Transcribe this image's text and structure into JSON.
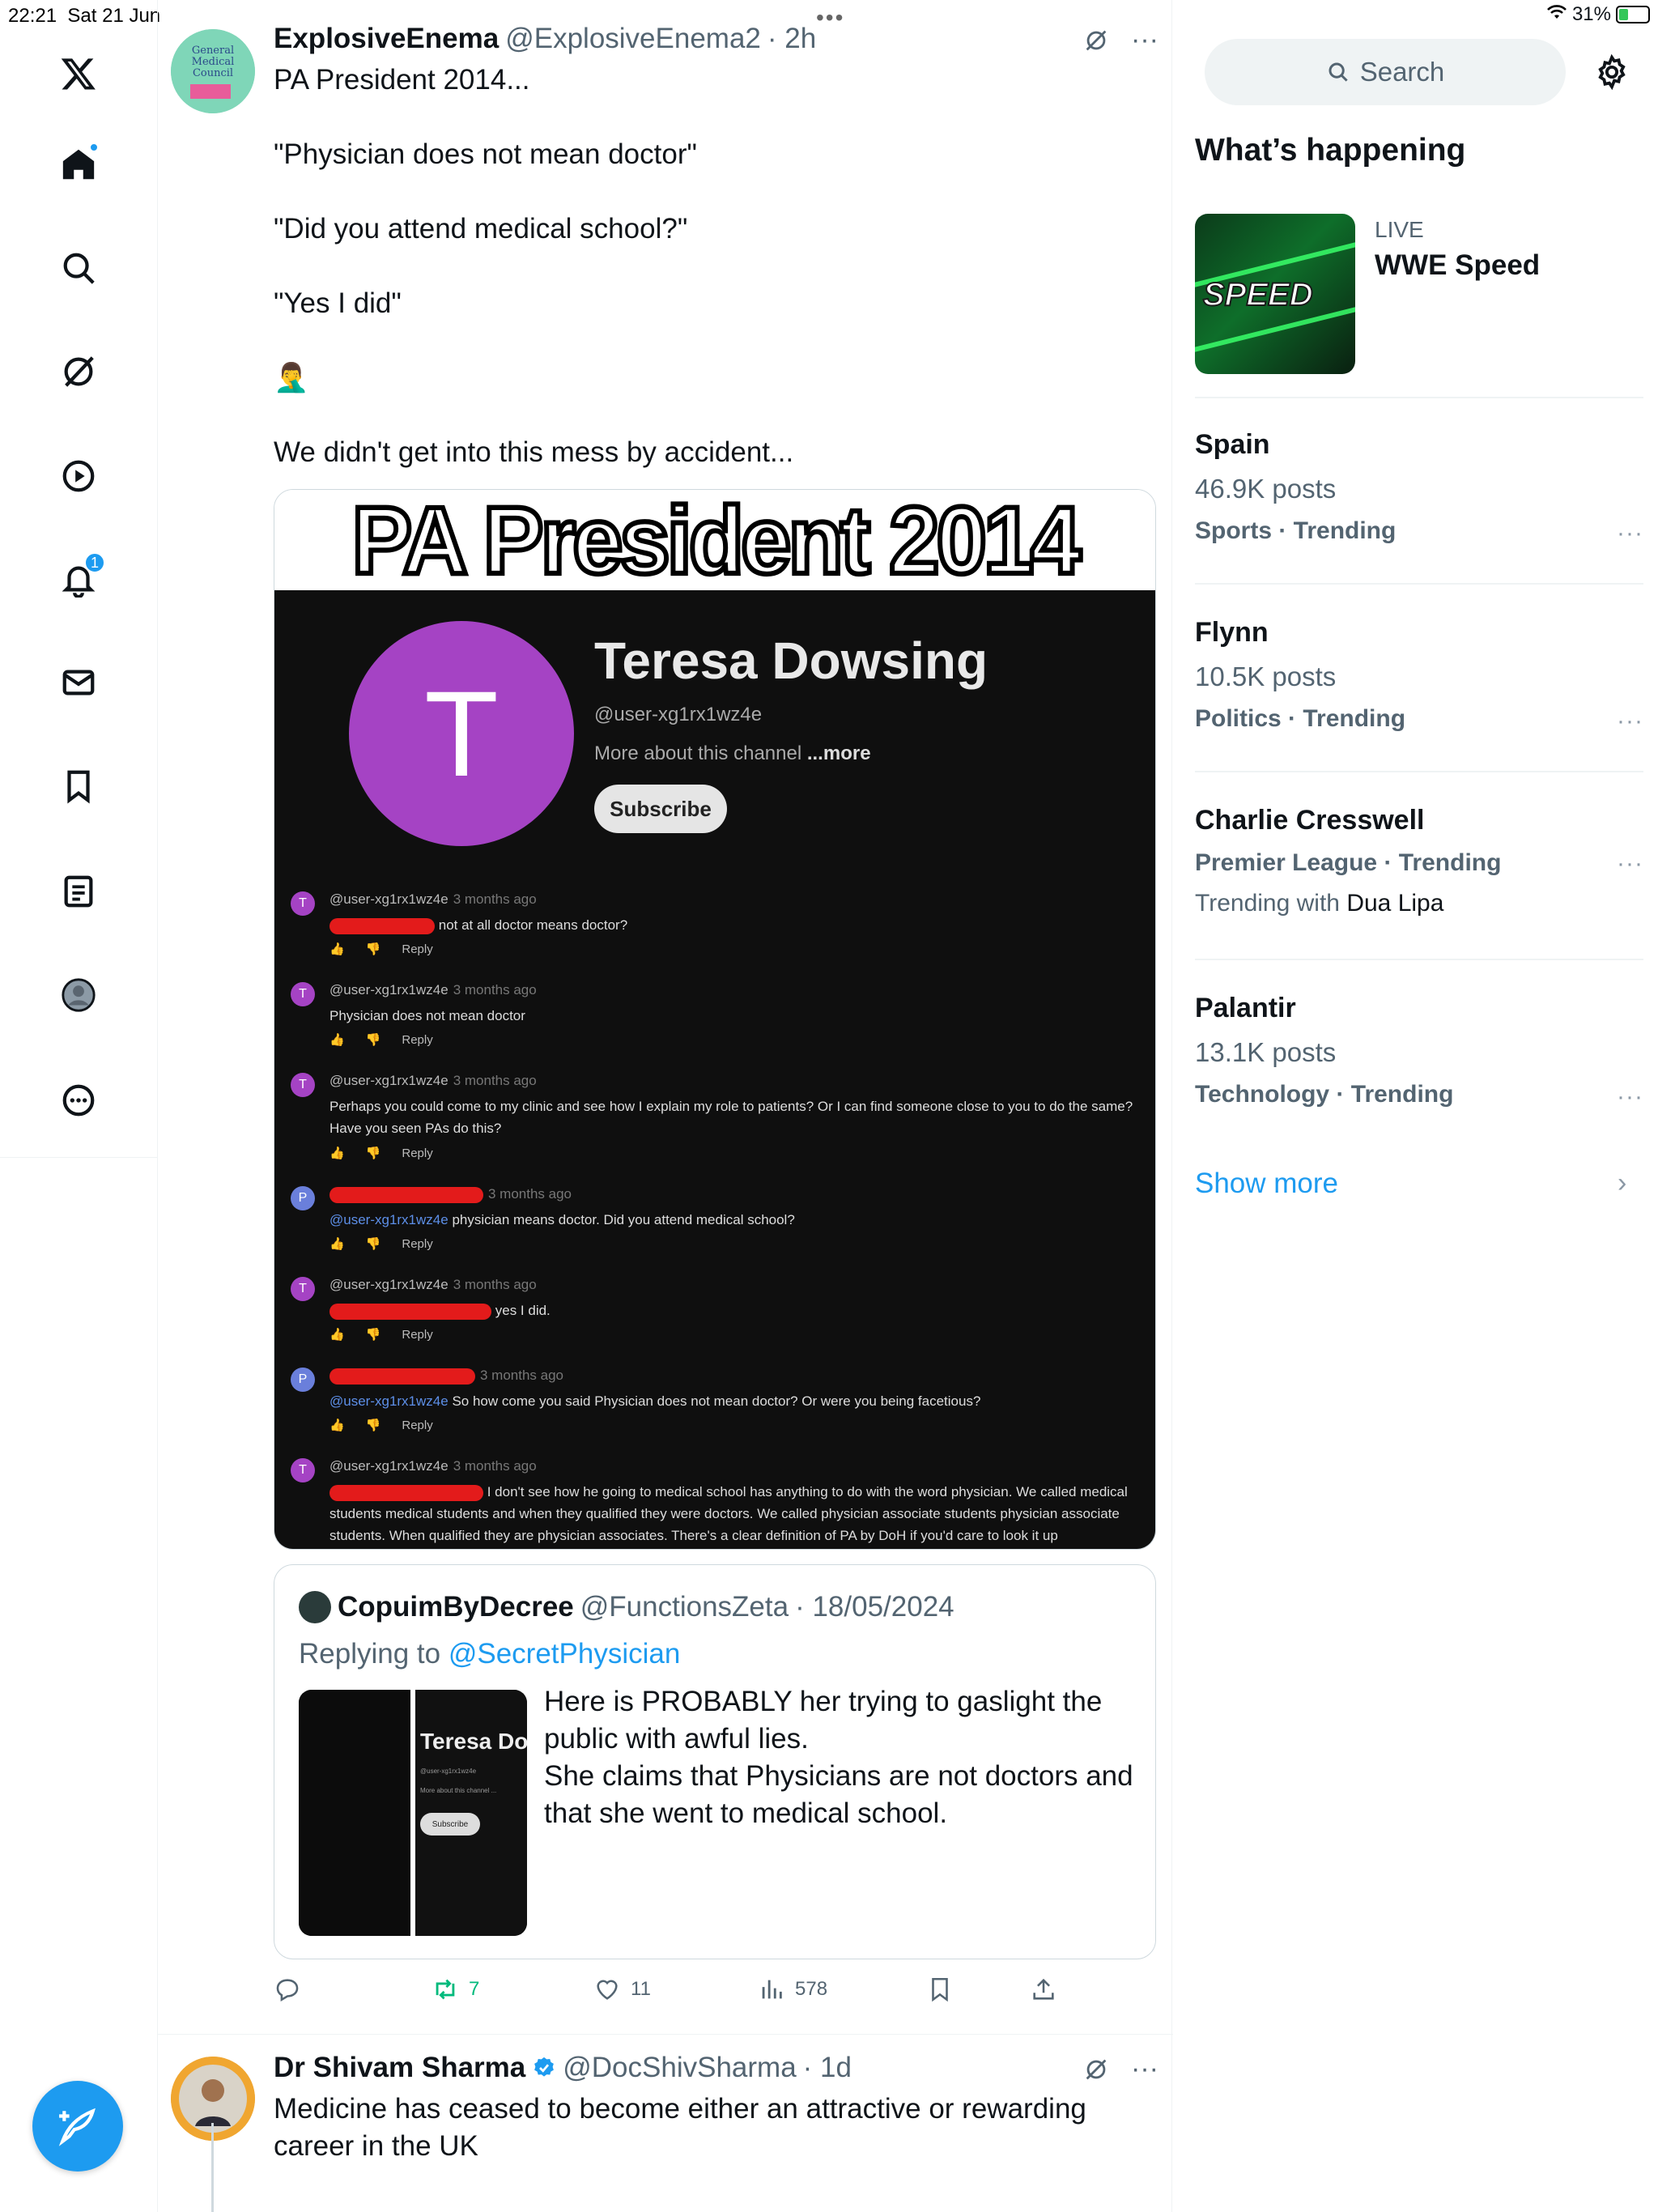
{
  "status": {
    "time": "22:21",
    "date": "Sat 21 Jun",
    "battery": "31%",
    "battery_level": 0.31
  },
  "nav": {
    "notifications_badge": "1"
  },
  "tweet1": {
    "name": "ExplosiveEnema",
    "handle": "@ExplosiveEnema2",
    "time": "· 2h",
    "lines": [
      "PA President 2014...",
      "\"Physician does not mean doctor\"",
      "\"Did you attend medical school?\"",
      "\"Yes I did\"",
      "🤦‍♂️",
      "We didn't get into this mess by accident..."
    ],
    "media": {
      "banner": "PA President 2014",
      "channel_initial": "T",
      "channel_name": "Teresa Dowsing",
      "channel_handle": "@user-xg1rx1wz4e",
      "channel_about": "More about this channel",
      "channel_more": "...more",
      "subscribe": "Subscribe",
      "reply_label": "Reply",
      "comments": [
        {
          "avatar": "T",
          "author": "@user-xg1rx1wz4e",
          "ago": "3 months ago",
          "text": "not at all doctor means doctor?"
        },
        {
          "avatar": "T",
          "author": "@user-xg1rx1wz4e",
          "ago": "3 months ago",
          "text": "Physician does not mean doctor"
        },
        {
          "avatar": "T",
          "author": "@user-xg1rx1wz4e",
          "ago": "3 months ago",
          "text": "Perhaps you could come to my clinic and see how I explain my role to patients? Or I can find someone close to you to do the same? Have you seen PAs do this?"
        },
        {
          "avatar": "P",
          "author": "",
          "ago": "3 months ago",
          "mention": "@user-xg1rx1wz4e",
          "text": "physician means doctor. Did you attend medical school?"
        },
        {
          "avatar": "T",
          "author": "@user-xg1rx1wz4e",
          "ago": "3 months ago",
          "text": "yes I did."
        },
        {
          "avatar": "P",
          "author": "",
          "ago": "3 months ago",
          "mention": "@user-xg1rx1wz4e",
          "text": "So how come you said Physician does not mean doctor? Or were you being facetious?"
        },
        {
          "avatar": "T",
          "author": "@user-xg1rx1wz4e",
          "ago": "3 months ago",
          "text": "I don't see how he going to medical school has anything to do with the word physician. We called medical students medical students and when they qualified they were doctors. We called physician associate students physician associate students. When qualified they are physician associates. There's a clear definition of PA by DoH if you'd care to look it up"
        }
      ]
    },
    "quote": {
      "name": "CopuimByDecree",
      "handle": "@FunctionsZeta",
      "date": "· 18/05/2024",
      "replying_prefix": "Replying to",
      "replying_to": "@SecretPhysician",
      "thumb_name": "Teresa Do",
      "thumb_handle": "@user-xg1rx1wz4e",
      "thumb_about": "More about this channel ...",
      "thumb_subscribe": "Subscribe",
      "text_lines": [
        "Here is PROBABLY her trying to gaslight the public with awful lies.",
        "She claims that Physicians are not doctors and that she went to medical school."
      ]
    },
    "stats": {
      "retweets": "7",
      "likes": "11",
      "views": "578"
    }
  },
  "tweet2": {
    "name": "Dr Shivam Sharma",
    "handle": "@DocShivSharma",
    "time": "· 1d",
    "text": "Medicine has ceased to become either an attractive or rewarding career in the UK"
  },
  "sidebar": {
    "search_placeholder": "Search",
    "heading": "What’s happening",
    "live": {
      "label": "LIVE",
      "title": "WWE Speed",
      "logo": "SPEED"
    },
    "trends": [
      {
        "name": "Spain",
        "count": "46.9K posts",
        "category": "Sports · Trending"
      },
      {
        "name": "Flynn",
        "count": "10.5K posts",
        "category": "Politics · Trending"
      },
      {
        "name": "Charlie Cresswell",
        "category": "Premier League · Trending",
        "with_prefix": "Trending with",
        "with_name": "Dua Lipa"
      },
      {
        "name": "Palantir",
        "count": "13.1K posts",
        "category": "Technology · Trending"
      }
    ],
    "more_label": "···",
    "show_more": "Show more",
    "show_more_chevron": "›"
  },
  "colors": {
    "accent": "#1d9bf0",
    "retweet_green": "#00ba7c",
    "text": "#0f1419",
    "muted": "#536471"
  }
}
